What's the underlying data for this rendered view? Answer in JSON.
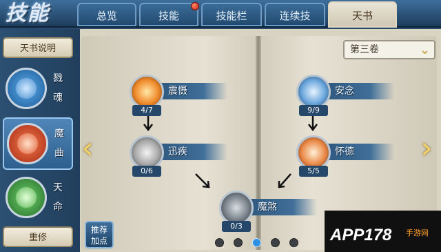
{
  "header": {
    "title_glyphs": "技能",
    "tabs": [
      {
        "label": "总览",
        "active": false,
        "badge": false
      },
      {
        "label": "技能",
        "active": false,
        "badge": true
      },
      {
        "label": "技能栏",
        "active": false,
        "badge": false
      },
      {
        "label": "连续技",
        "active": false,
        "badge": false
      },
      {
        "label": "天书",
        "active": true,
        "badge": false
      }
    ]
  },
  "sidebar": {
    "help_button": "天书说明",
    "books": [
      {
        "name": "戮魂",
        "selected": false,
        "color": "#2f7fc4"
      },
      {
        "name": "魔曲",
        "selected": true,
        "color": "#d2452a"
      },
      {
        "name": "天命",
        "selected": false,
        "color": "#3f9a44"
      }
    ],
    "reset_button": "重修"
  },
  "main": {
    "volume_selector": "第三卷",
    "skills": [
      {
        "name": "震慑",
        "count": "4/7",
        "icon": "fire-fist-icon"
      },
      {
        "name": "迅疾",
        "count": "0/6",
        "icon": "swift-wind-icon"
      },
      {
        "name": "安念",
        "count": "9/9",
        "icon": "calm-mind-icon"
      },
      {
        "name": "怀德",
        "count": "5/5",
        "icon": "virtue-flame-icon"
      },
      {
        "name": "魔煞",
        "count": "0/3",
        "icon": "demon-fury-icon"
      }
    ],
    "recommend_button": "推荐\n加点",
    "pages": {
      "count": 5,
      "current": 3
    }
  },
  "watermark": {
    "brand": "APP178",
    "suffix": "手游网"
  }
}
